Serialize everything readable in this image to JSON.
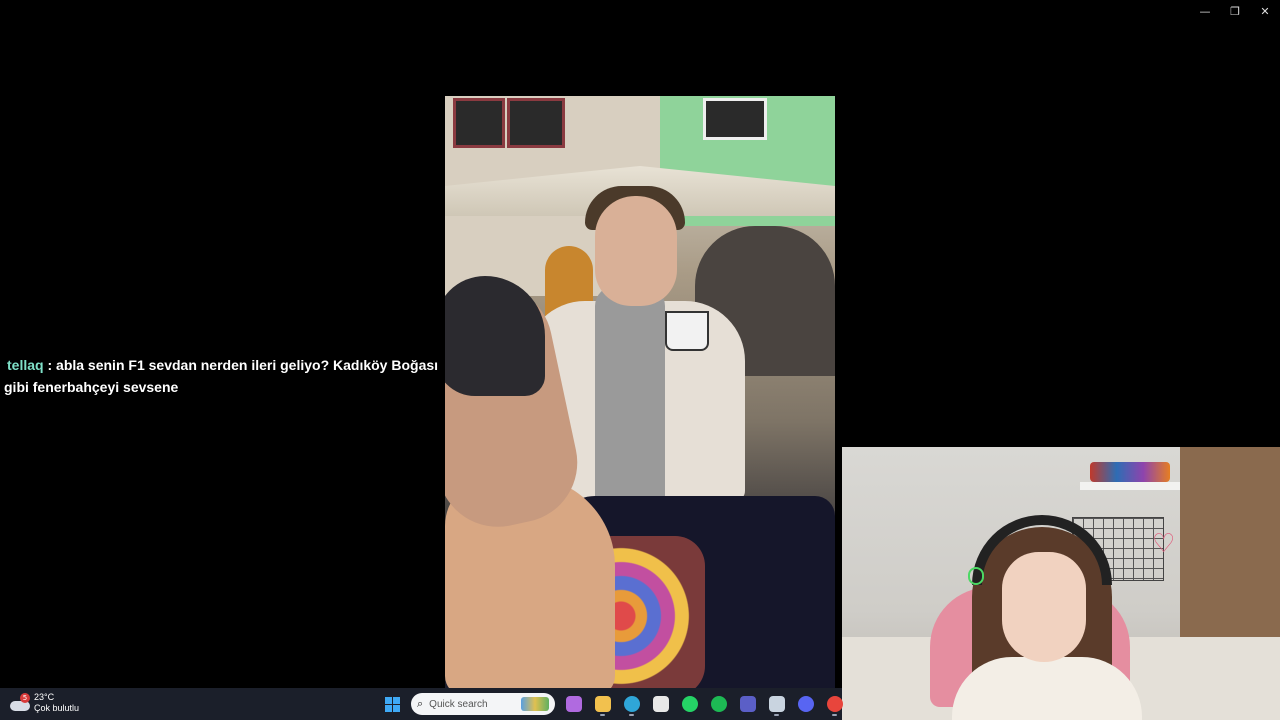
{
  "window_controls": {
    "minimize_glyph": "—",
    "restore_glyph": "❐",
    "close_glyph": "✕"
  },
  "chat": {
    "username": "tellaq",
    "separator": " : ",
    "message": "abla senin F1 sevdan nerden ileri geliyo? Kadıköy Boğası gibi fenerbahçeyi sevsene"
  },
  "taskbar": {
    "weather": {
      "temperature": "23°C",
      "condition": "Çok bulutlu",
      "badge": "5"
    },
    "search_placeholder": "Quick search",
    "apps": [
      {
        "name": "copilot-icon",
        "color": "#b06ae0"
      },
      {
        "name": "file-explorer-icon",
        "color": "#f2c14e"
      },
      {
        "name": "edge-icon",
        "color": "#2fa6d8"
      },
      {
        "name": "store-icon",
        "color": "#e8e8e8"
      },
      {
        "name": "whatsapp-icon",
        "color": "#25d366"
      },
      {
        "name": "spotify-icon",
        "color": "#1db954"
      },
      {
        "name": "teams-icon",
        "color": "#5b5fc7"
      },
      {
        "name": "obs-like-icon",
        "color": "#c9d4e0"
      },
      {
        "name": "discord-icon",
        "color": "#5865f2"
      },
      {
        "name": "chrome-icon",
        "color": "#e8453c"
      }
    ]
  }
}
